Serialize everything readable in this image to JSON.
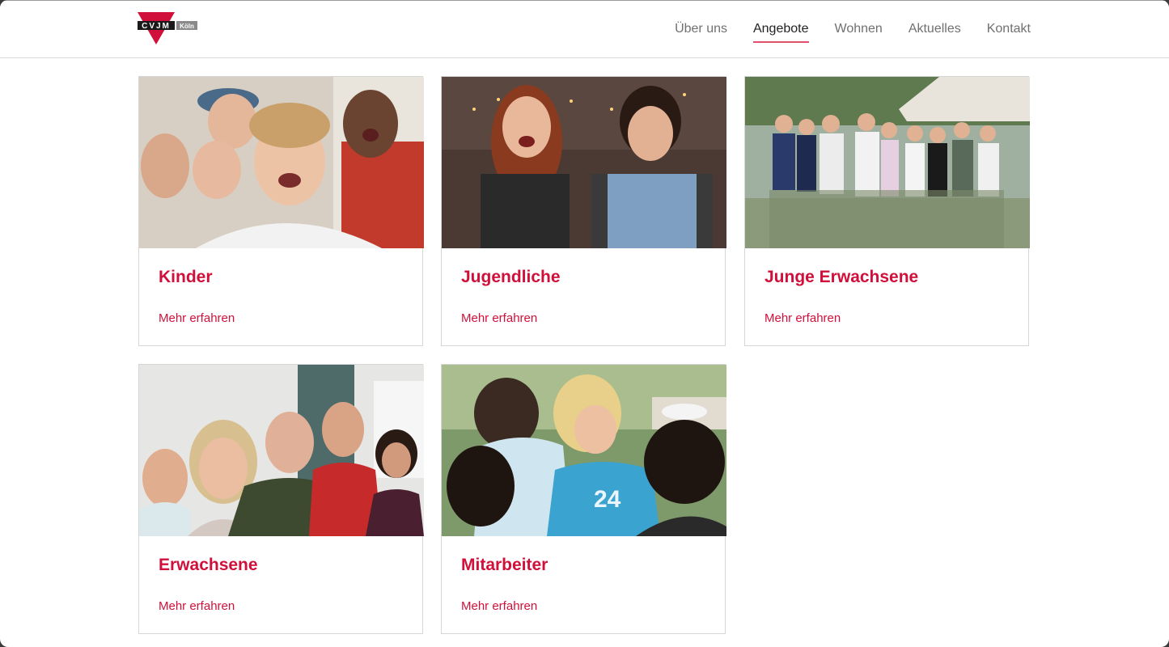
{
  "brand": {
    "logo_letters": "CVJM",
    "logo_tag": "Köln",
    "accent_color": "#d0103a"
  },
  "nav": {
    "items": [
      {
        "label": "Über uns"
      },
      {
        "label": "Angebote",
        "active": true
      },
      {
        "label": "Wohnen"
      },
      {
        "label": "Aktuelles"
      },
      {
        "label": "Kontakt"
      }
    ]
  },
  "cards": [
    {
      "title": "Kinder",
      "link": "Mehr erfahren",
      "image": "group-of-children-selfie"
    },
    {
      "title": "Jugendliche",
      "link": "Mehr erfahren",
      "image": "two-teen-girls-on-sofa"
    },
    {
      "title": "Junge Erwachsene",
      "link": "Mehr erfahren",
      "image": "young-adults-group-outdoors"
    },
    {
      "title": "Erwachsene",
      "link": "Mehr erfahren",
      "image": "adults-group-portrait"
    },
    {
      "title": "Mitarbeiter",
      "link": "Mehr erfahren",
      "image": "girls-crafting-outdoors"
    }
  ]
}
